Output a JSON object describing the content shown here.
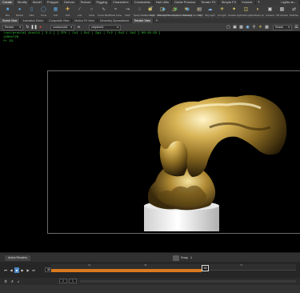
{
  "menubar": {
    "tabs": [
      {
        "label": "Create",
        "active": true
      },
      {
        "label": "Modify"
      },
      {
        "label": "Model"
      },
      {
        "label": "Polygon"
      },
      {
        "label": "Deform"
      },
      {
        "label": "Texture"
      },
      {
        "label": "Rigging"
      },
      {
        "label": "Characters"
      },
      {
        "label": "Constraints"
      },
      {
        "label": "Hair Utils"
      },
      {
        "label": "Guide Process"
      },
      {
        "label": "Terrain FX"
      },
      {
        "label": "Simple FX"
      },
      {
        "label": "Volume"
      }
    ],
    "right_tab": "Lights an..."
  },
  "shelf": {
    "tools": [
      {
        "label": "Box",
        "icon": "box-icon",
        "color": "#5aa0d8"
      },
      {
        "label": "Sphere",
        "icon": "sphere-icon",
        "color": "#5aa0d8"
      },
      {
        "label": "Tube",
        "icon": "tube-icon",
        "color": "#5aa0d8"
      },
      {
        "label": "Torus",
        "icon": "torus-icon",
        "color": "#5aa0d8"
      },
      {
        "label": "Grid",
        "icon": "grid-icon",
        "color": "#5aa0d8"
      },
      {
        "label": "Null",
        "icon": "null-icon",
        "color": "#d4a84c"
      },
      {
        "label": "Line",
        "icon": "line-icon",
        "color": "#bbbbbb"
      },
      {
        "label": "Circle",
        "icon": "circle-icon",
        "color": "#bbbbbb"
      },
      {
        "label": "Curve Bezier",
        "icon": "curve-bezier-icon",
        "color": "#bbbbbb"
      },
      {
        "label": "Draw Curve",
        "icon": "draw-curve-icon",
        "color": "#bbbbbb"
      },
      {
        "label": "Path",
        "icon": "path-icon",
        "color": "#bbbbbb"
      },
      {
        "label": "Spray Paint",
        "icon": "spray-paint-icon",
        "color": "#bbbbbb"
      },
      {
        "label": "Text",
        "icon": "text-icon",
        "color": "#bbbbbb"
      },
      {
        "label": "Platonic Solids",
        "icon": "platonic-icon",
        "color": "#5aa0d8"
      },
      {
        "label": "L-System",
        "icon": "lsystem-icon",
        "color": "#66c066"
      },
      {
        "label": "Metaball",
        "icon": "metaball-icon",
        "color": "#5aa0d8"
      },
      {
        "label": "File",
        "icon": "file-icon",
        "color": "#bbbbbb"
      }
    ],
    "right_tools": [
      {
        "label": "Spot Light",
        "icon": "spot-light-icon"
      },
      {
        "label": "Area Light",
        "icon": "area-light-icon"
      },
      {
        "label": "Geometry Light",
        "icon": "geometry-light-icon"
      },
      {
        "label": "Volume Light",
        "icon": "volume-light-icon"
      },
      {
        "label": "Env Light",
        "icon": "env-light-icon"
      },
      {
        "label": "Sky Light",
        "icon": "sky-light-icon"
      },
      {
        "label": "GI Light",
        "icon": "gi-light-icon"
      },
      {
        "label": "Caustic Light",
        "icon": "caustic-light-icon"
      },
      {
        "label": "Portal Light",
        "icon": "portal-light-icon"
      },
      {
        "label": "Ambient Light",
        "icon": "ambient-light-icon"
      },
      {
        "label": "Camera",
        "icon": "camera-icon"
      },
      {
        "label": "VR Camera",
        "icon": "vr-camera-icon"
      },
      {
        "label": "Switcher",
        "icon": "switcher-icon"
      }
    ]
  },
  "viewtabs": [
    {
      "label": "Scene View",
      "active": true
    },
    {
      "label": "Animation Editor"
    },
    {
      "label": "Composite View"
    },
    {
      "label": "Motion FX View"
    },
    {
      "label": "Geometry Spreadsheet"
    },
    {
      "label": "Render View"
    }
  ],
  "viewtoolbar": {
    "renderer": "Render",
    "camera": "/out/arnold1",
    "output": "/obj/shell1",
    "right_dropdown": "Shade"
  },
  "viewport": {
    "status_line": "/out/arnold1 Arnold [ 3.2 ]  [ CPU | Cs1 | Ds1 | Sp1 | Tr2 | Ss2 | Vo2 ]  00:10:33 ]",
    "resolution": "1280x720",
    "frame_info": "fr 33"
  },
  "bottombar": {
    "tab": "Active Renders",
    "snap_label": "Snap",
    "snap_value": "1"
  },
  "timeline": {
    "current_frame": "33",
    "frame_field": "33",
    "marker_label": "33",
    "ticks": [
      "24",
      "48",
      "72"
    ],
    "range_start": "1",
    "range_end": "1",
    "progress": 0.61
  },
  "colors": {
    "accent_orange": "#d97a1d",
    "status_green": "#3cd23c",
    "play_blue": "#4d88c8"
  }
}
